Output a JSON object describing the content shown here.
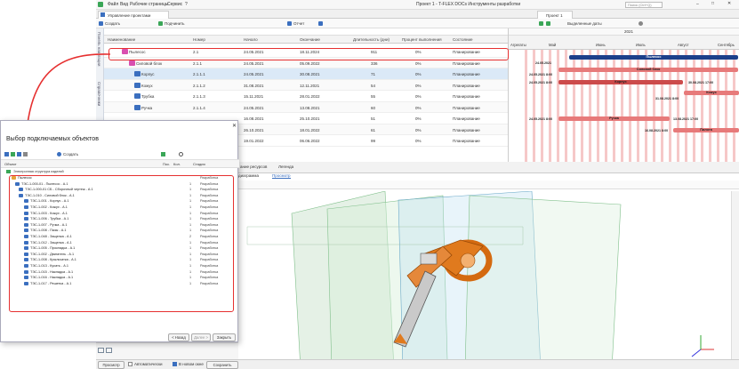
{
  "menu": {
    "items": [
      "Файл",
      "Вид",
      "Рабочие страницы",
      "Сервис",
      "?"
    ],
    "app_title": "Проект 1 - T-FLEX DOCs Инструменты разработки",
    "search_placeholder": "Поиск (Ctrl+Q)"
  },
  "doc_tabs": {
    "left_tab": "Управление проектами",
    "right_tab": "Проект 1"
  },
  "toolbar": {
    "create": "Создать",
    "subordinate": "Подчинить",
    "report": "Отчет",
    "highlight_dates": "Выделенные даты"
  },
  "side_labels": [
    "Панель навигации",
    "Справочники"
  ],
  "table": {
    "headers": [
      "Наименование",
      "Номер",
      "Начало",
      "Окончание",
      "Длительность (дни)",
      "Процент выполнения",
      "Состояние"
    ],
    "rows": [
      {
        "name": "Пылесос",
        "number": "2.1",
        "start": "24.05.2021",
        "end": "18.11.2024",
        "duration": "911",
        "percent": "0%",
        "state": "Планирование"
      },
      {
        "name": "Силовой блок",
        "number": "2.1.1",
        "start": "24.05.2021",
        "end": "05.09.2022",
        "duration": "336",
        "percent": "0%",
        "state": "Планирование"
      },
      {
        "name": "Корпус",
        "number": "2.1.1.1",
        "start": "24.05.2021",
        "end": "30.08.2021",
        "duration": "71",
        "percent": "0%",
        "state": "Планирование"
      },
      {
        "name": "Кожух",
        "number": "2.1.1.2",
        "start": "31.08.2021",
        "end": "12.11.2021",
        "duration": "54",
        "percent": "0%",
        "state": "Планирование"
      },
      {
        "name": "Трубка",
        "number": "2.1.1.3",
        "start": "15.11.2021",
        "end": "28.01.2022",
        "duration": "55",
        "percent": "0%",
        "state": "Планирование"
      },
      {
        "name": "Ручка",
        "number": "2.1.1.4",
        "start": "24.05.2021",
        "end": "13.08.2021",
        "duration": "60",
        "percent": "0%",
        "state": "Планирование"
      },
      {
        "name": "",
        "number": "",
        "start": "16.08.2021",
        "end": "25.10.2021",
        "duration": "51",
        "percent": "0%",
        "state": "Планирование"
      },
      {
        "name": "",
        "number": "",
        "start": "26.10.2021",
        "end": "18.01.2022",
        "duration": "61",
        "percent": "0%",
        "state": "Планирование"
      },
      {
        "name": "",
        "number": "",
        "start": "19.01.2022",
        "end": "06.06.2022",
        "duration": "99",
        "percent": "0%",
        "state": "Планирование"
      }
    ]
  },
  "gantt": {
    "year": "2021",
    "groups": "Агрегаты",
    "months": [
      "Май",
      "Июнь",
      "Июль",
      "Август",
      "Сентябрь"
    ],
    "bars": [
      {
        "label": "Пылесос",
        "date": "24.05.2021"
      },
      {
        "label": "Силовой блок",
        "date": "24.05.2021 8:00"
      },
      {
        "label": "Корпус",
        "date": "24.05.2021 8:00",
        "end": "30.08.2021 17:00"
      },
      {
        "label": "Кожух",
        "date": "31.08.2021 8:00"
      },
      {
        "label": "Ручка",
        "date": "24.05.2021 8:00",
        "end": "13.08.2021 17:00"
      },
      {
        "label": "Пилота",
        "date": "16.08.2021 8:00"
      }
    ]
  },
  "dialog": {
    "title": "Выбор подключаемых объектов",
    "create": "Создать",
    "col_object": "Объект",
    "col_qty": "Пос.",
    "col_count": "Кол.",
    "col_stage": "Стадия",
    "root": "Электронная структура изделий",
    "items": [
      {
        "name": "Пылесос",
        "qty": "",
        "stage": "Разработка"
      },
      {
        "name": "ТЭС-1-000-01 - Пылесос - А.1",
        "qty": "1",
        "stage": "Разработка"
      },
      {
        "name": "ТЭС-1-000-01 СБ - Сборочный чертеж - А.1",
        "qty": "1",
        "stage": "Разработка"
      },
      {
        "name": "ТЭС-1-010 - Силовой блок - А.1",
        "qty": "1",
        "stage": "Разработка"
      },
      {
        "name": "ТЭС-1-001 - Корпус - А.1",
        "qty": "1",
        "stage": "Разработка"
      },
      {
        "name": "ТЭС-1-002 - Кожух - А.1",
        "qty": "1",
        "stage": "Разработка"
      },
      {
        "name": "ТЭС-1-003 - Кожух - А.1",
        "qty": "1",
        "stage": "Разработка"
      },
      {
        "name": "ТЭС-1-006 - Трубка - А.1",
        "qty": "1",
        "stage": "Разработка"
      },
      {
        "name": "ТЭС-1-007 - Ручка - А.1",
        "qty": "1",
        "stage": "Разработка"
      },
      {
        "name": "ТЭС-1-008 - Пазы - А.1",
        "qty": "1",
        "stage": "Разработка"
      },
      {
        "name": "ТЭС-1-048 - Защелка - А.1",
        "qty": "2",
        "stage": "Разработка"
      },
      {
        "name": "ТЭС-1-012 - Защелка - А.1",
        "qty": "1",
        "stage": "Разработка"
      },
      {
        "name": "ТЭС-1-005 - Прокладка - А.1",
        "qty": "1",
        "stage": "Разработка"
      },
      {
        "name": "ТЭС-1-002 - Двигатель - А.1",
        "qty": "1",
        "stage": "Разработка"
      },
      {
        "name": "ТЭС-1-008 - Крыльчатка - А.1",
        "qty": "1",
        "stage": "Разработка"
      },
      {
        "name": "ТЭС-1-013 - Кусать - А.1",
        "qty": "1",
        "stage": "Разработка"
      },
      {
        "name": "ТЭС-1-015 - Накладка - А.1",
        "qty": "1",
        "stage": "Разработка"
      },
      {
        "name": "ТЭС-1-016 - Накладка - А.1",
        "qty": "1",
        "stage": "Разработка"
      },
      {
        "name": "ТЭС-1-017 - Решетка - А.1",
        "qty": "1",
        "stage": "Разработка"
      }
    ],
    "btn_back": "< Назад",
    "btn_next": "Далее >",
    "btn_close": "Закрыть"
  },
  "viewer": {
    "tab1": "ание ресурсов",
    "tab2": "Легенда",
    "tab3": "диаграмма",
    "tab4": "Просмотр"
  },
  "bottom": {
    "viewer_btn": "Просмотр",
    "auto": "Автоматически",
    "new_window": "В новом окне",
    "save": "Сохранить"
  },
  "colors": {
    "accent": "#3b6fbf",
    "gantt_bar": "#e77a7a",
    "highlight": "#e63030",
    "model_orange": "#e07a1e"
  }
}
